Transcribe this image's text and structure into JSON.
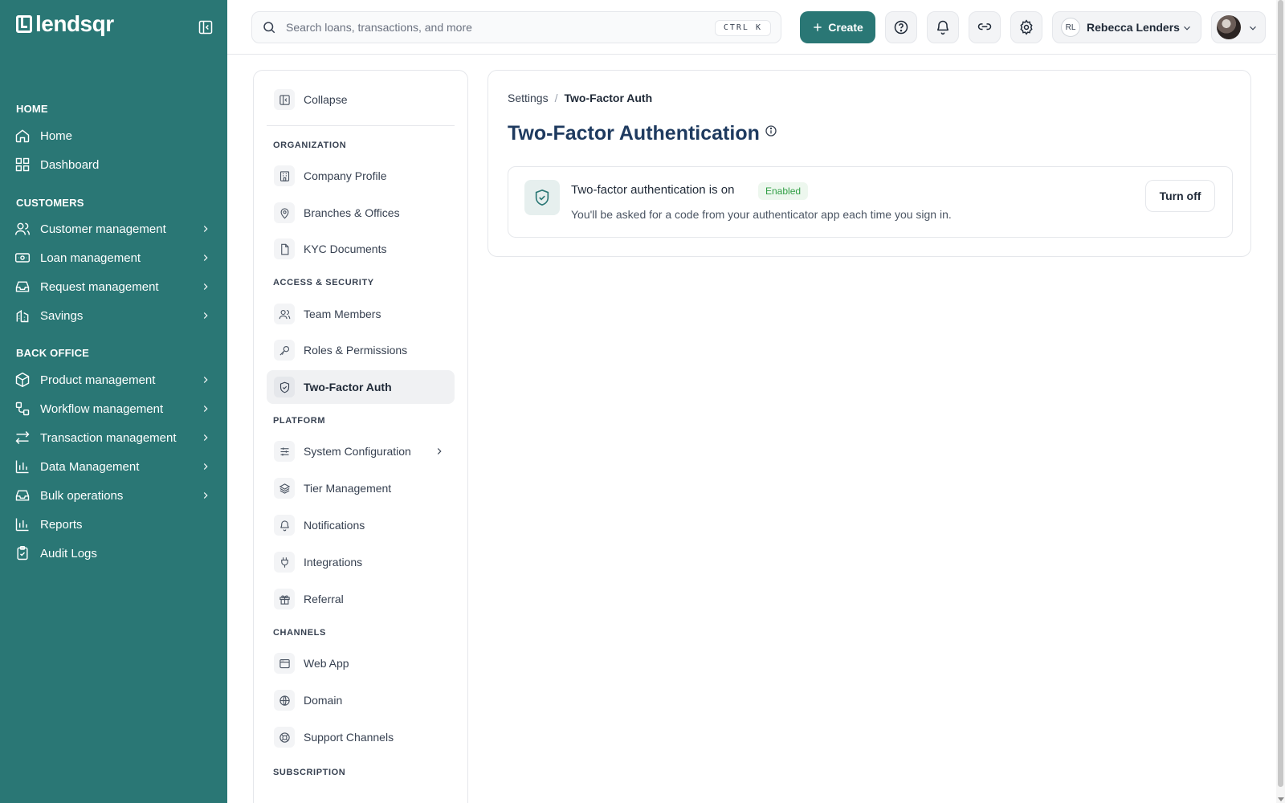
{
  "brand": {
    "name": "lendsqr"
  },
  "sidebar": {
    "sections": [
      "HOME",
      "CUSTOMERS",
      "BACK OFFICE"
    ],
    "items": [
      {
        "label": "Home",
        "icon": "home-icon"
      },
      {
        "label": "Dashboard",
        "icon": "dashboard-icon"
      },
      {
        "label": "Customer management",
        "icon": "users-icon"
      },
      {
        "label": "Loan management",
        "icon": "banknote-icon"
      },
      {
        "label": "Request management",
        "icon": "inbox-icon"
      },
      {
        "label": "Savings",
        "icon": "bank-icon"
      },
      {
        "label": "Product management",
        "icon": "box-icon"
      },
      {
        "label": "Workflow management",
        "icon": "workflow-icon"
      },
      {
        "label": "Transaction management",
        "icon": "transfer-icon"
      },
      {
        "label": "Data Management",
        "icon": "chart-icon"
      },
      {
        "label": "Bulk operations",
        "icon": "inbox-icon"
      },
      {
        "label": "Reports",
        "icon": "chart-icon"
      },
      {
        "label": "Audit Logs",
        "icon": "clipboard-check-icon"
      }
    ]
  },
  "topbar": {
    "search_placeholder": "Search loans, transactions, and more",
    "shortcut": "CTRL K",
    "create_label": "Create",
    "account_initials": "RL",
    "account_name": "Rebecca Lenders"
  },
  "settings_nav": {
    "collapse_label": "Collapse",
    "sections": [
      "ORGANIZATION",
      "ACCESS & SECURITY",
      "PLATFORM",
      "CHANNELS",
      "SUBSCRIPTION"
    ],
    "items": [
      {
        "label": "Company Profile",
        "icon": "building-icon"
      },
      {
        "label": "Branches & Offices",
        "icon": "map-pin-icon"
      },
      {
        "label": "KYC Documents",
        "icon": "document-icon"
      },
      {
        "label": "Team Members",
        "icon": "users-icon"
      },
      {
        "label": "Roles & Permissions",
        "icon": "key-icon"
      },
      {
        "label": "Two-Factor Auth",
        "icon": "shield-check-icon",
        "active": true
      },
      {
        "label": "System Configuration",
        "icon": "sliders-icon"
      },
      {
        "label": "Tier Management",
        "icon": "layers-icon"
      },
      {
        "label": "Notifications",
        "icon": "bell-icon"
      },
      {
        "label": "Integrations",
        "icon": "plug-icon"
      },
      {
        "label": "Referral",
        "icon": "gift-icon"
      },
      {
        "label": "Web App",
        "icon": "browser-icon"
      },
      {
        "label": "Domain",
        "icon": "globe-icon"
      },
      {
        "label": "Support Channels",
        "icon": "lifebuoy-icon"
      }
    ]
  },
  "main": {
    "breadcrumb": {
      "parent": "Settings",
      "separator": "/",
      "current": "Two-Factor Auth"
    },
    "title": "Two-Factor Authentication",
    "tfa": {
      "heading": "Two-factor authentication is on",
      "badge": "Enabled",
      "description": "You'll be asked for a code from your authenticator app each time you sign in.",
      "turn_off_label": "Turn off"
    }
  },
  "colors": {
    "sidebar_bg": "#2a7775",
    "accent": "#2a7775",
    "title": "#1e3a5f",
    "badge_text": "#2f9e44",
    "badge_bg": "#edf7ee"
  }
}
